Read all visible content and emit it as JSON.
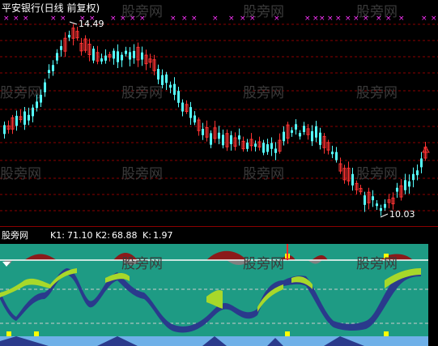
{
  "upper": {
    "title": "平安银行(日线 前复权)",
    "high_label": "14.49",
    "low_label": "10.03"
  },
  "lower": {
    "name": "股旁网",
    "k1_label": "K1:",
    "k1_value": "71.10",
    "k2_label": "K2:",
    "k2_value": "68.88",
    "k_label": "K:",
    "k_value": "1.97"
  },
  "watermark_text": "股旁网",
  "colors": {
    "up": "#ff3333",
    "down": "#55ffff",
    "panel_bg": "#1e9b84",
    "grid": "#8b0000",
    "label_yellow": "#ffff00",
    "marker_magenta": "#ff33ff"
  }
}
